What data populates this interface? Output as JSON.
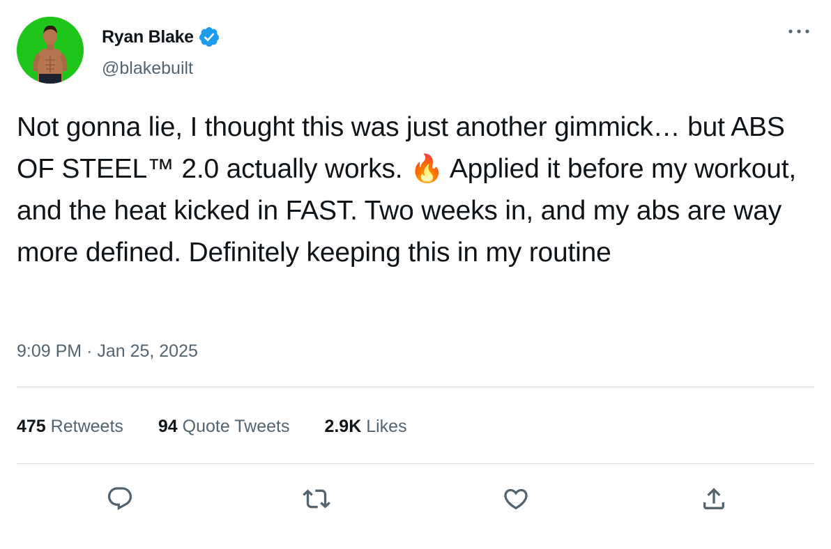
{
  "author": {
    "display_name": "Ryan Blake",
    "handle": "@blakebuilt",
    "verified": true,
    "avatar_bg": "#1fc51a"
  },
  "tweet": {
    "text": "Not gonna lie, I thought this was just another gimmick… but ABS OF STEEL™ 2.0 actually works. 🔥 Applied it before my workout, and the heat kicked in FAST. Two weeks in, and my abs are way more defined. Definitely keeping this in my routine",
    "timestamp": "9:09 PM · Jan 25, 2025"
  },
  "stats": {
    "retweets_count": "475",
    "retweets_label": "Retweets",
    "quotes_count": "94",
    "quotes_label": "Quote Tweets",
    "likes_count": "2.9K",
    "likes_label": "Likes"
  },
  "icons": {
    "verified": "verified-badge-icon",
    "more": "more-dots-icon",
    "reply": "reply-icon",
    "retweet": "retweet-icon",
    "like": "heart-icon",
    "share": "share-icon"
  },
  "colors": {
    "text": "#0f1419",
    "secondary": "#536471",
    "verified": "#1d9bf0",
    "divider": "#cfd9de"
  }
}
